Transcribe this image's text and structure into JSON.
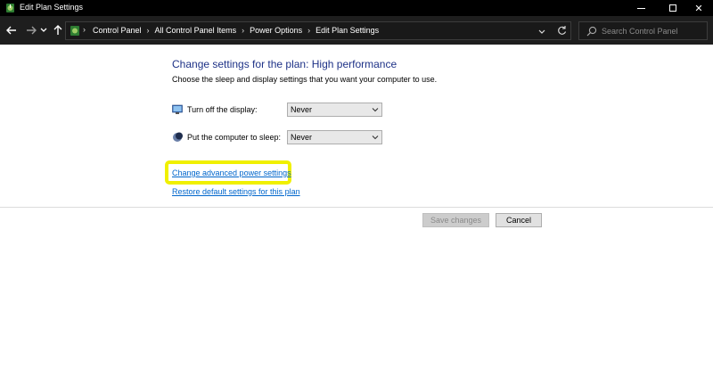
{
  "window": {
    "title": "Edit Plan Settings",
    "minimize": "minimize",
    "maximize": "maximize",
    "close": "✕"
  },
  "navigation": {
    "back": "🡐",
    "forward": "🡒",
    "recent": "⌄",
    "up": "🡑",
    "breadcrumbs": [
      "Control Panel",
      "All Control Panel Items",
      "Power Options",
      "Edit Plan Settings"
    ],
    "dropdown": "⌄",
    "refresh": "↻"
  },
  "search": {
    "placeholder": "Search Control Panel"
  },
  "content": {
    "heading": "Change settings for the plan: High performance",
    "subtitle": "Choose the sleep and display settings that you want your computer to use.",
    "settings": [
      {
        "label": "Turn off the display:",
        "value": "Never",
        "icon": "monitor-icon"
      },
      {
        "label": "Put the computer to sleep:",
        "value": "Never",
        "icon": "moon-icon"
      }
    ],
    "links": {
      "advanced": "Change advanced power settings",
      "restore": "Restore default settings for this plan"
    }
  },
  "actions": {
    "save": "Save changes",
    "cancel": "Cancel"
  },
  "colors": {
    "heading": "#1e3287",
    "link": "#0066cc",
    "highlight": "#f0f000",
    "titlebar": "#000000",
    "navbar": "#1e1e1e"
  }
}
